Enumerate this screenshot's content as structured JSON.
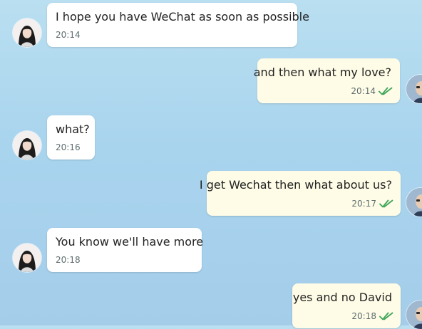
{
  "messages": [
    {
      "side": "in",
      "text": "I hope you have WeChat as soon as possible",
      "time": "20:14"
    },
    {
      "side": "out",
      "text": "and then what my love?",
      "time": "20:14",
      "read": true
    },
    {
      "side": "in",
      "text": "what?",
      "time": "20:16"
    },
    {
      "side": "out",
      "text": "I get Wechat then what about us?",
      "time": "20:17",
      "read": true
    },
    {
      "side": "in",
      "text": "You know we'll have more",
      "time": "20:18"
    },
    {
      "side": "out",
      "text": "yes and no David",
      "time": "20:18",
      "read": true
    }
  ],
  "icons": {
    "read_receipt": "double-check-icon",
    "incoming_avatar": "woman-avatar",
    "outgoing_avatar": "man-avatar"
  },
  "colors": {
    "incoming_bubble": "#ffffff",
    "outgoing_bubble": "#fefce6",
    "read_check": "#3ea55a",
    "background_top": "#b9dff0",
    "background_bottom": "#a4cdea"
  }
}
